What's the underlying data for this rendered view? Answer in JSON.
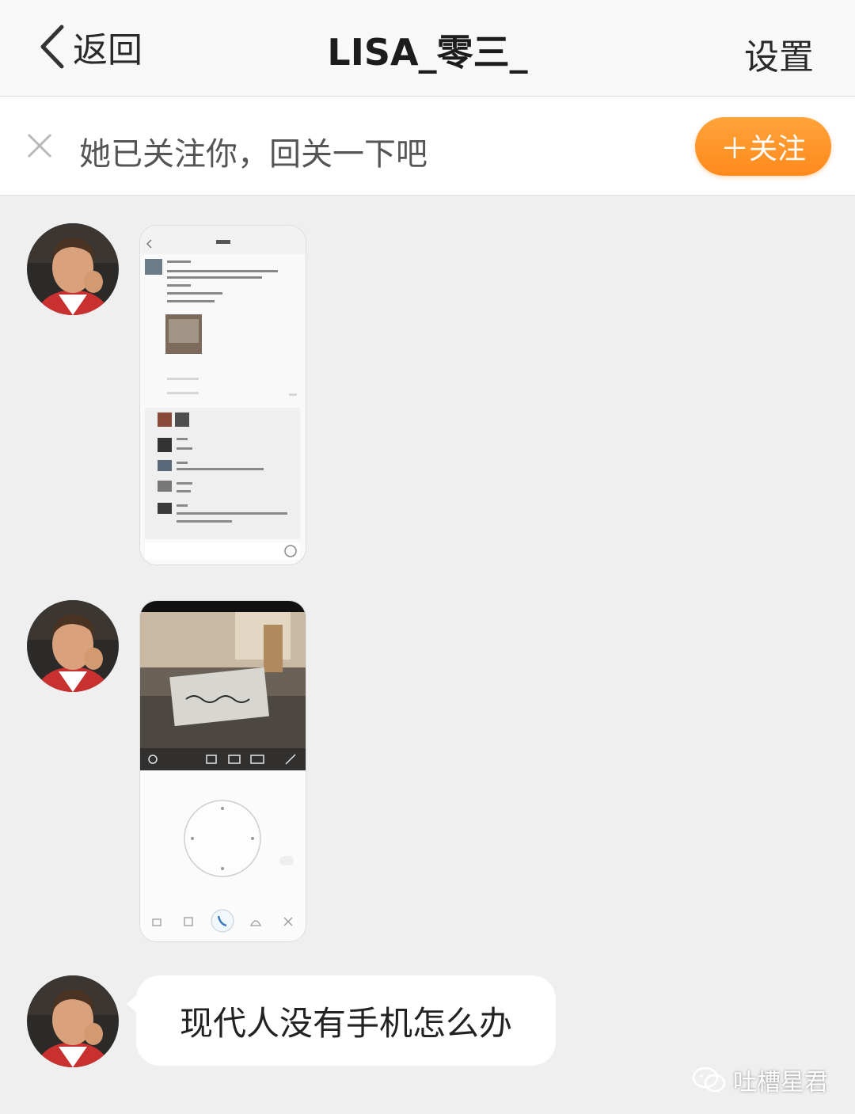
{
  "nav": {
    "back_label": "返回",
    "title": "LISA_零三_",
    "settings_label": "设置"
  },
  "follow_bar": {
    "message": "她已关注你，回关一下吧",
    "button_label": "＋关注",
    "button_color": "#FF8A1C"
  },
  "messages": [
    {
      "type": "image",
      "content": "screenshot-of-chat-thread"
    },
    {
      "type": "image",
      "content": "screenshot-of-camera-app"
    },
    {
      "type": "text",
      "text": "现代人没有手机怎么办"
    }
  ],
  "watermark": {
    "text": "吐槽星君",
    "icon": "wechat-icon"
  }
}
